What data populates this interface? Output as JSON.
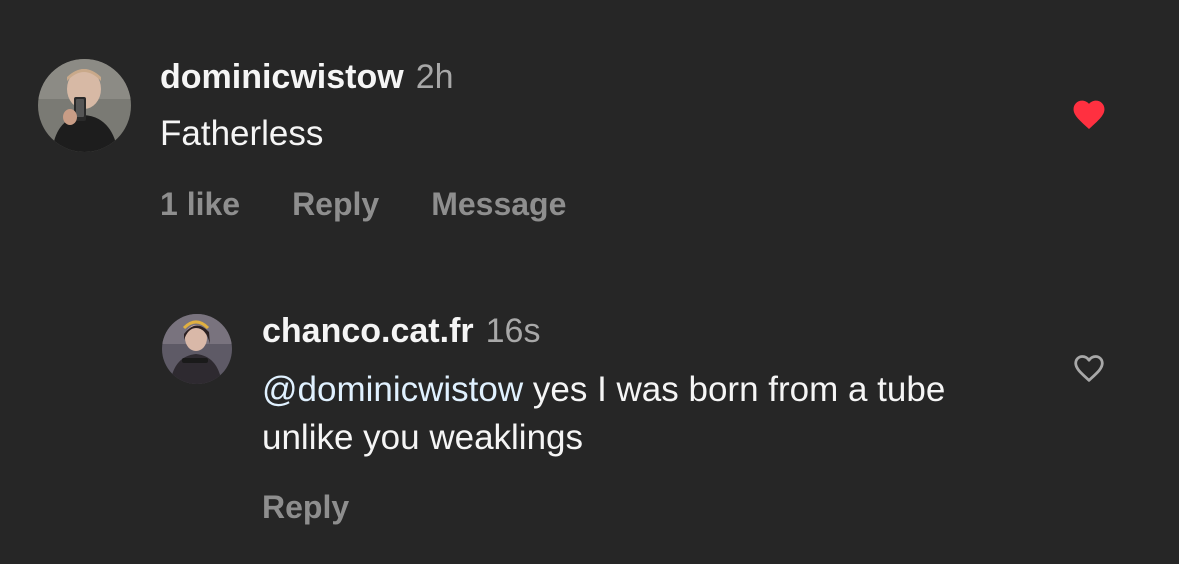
{
  "comments": [
    {
      "username": "dominicwistow",
      "time": "2h",
      "text": "Fatherless",
      "liked": true,
      "likes_label": "1 like",
      "reply_label": "Reply",
      "message_label": "Message"
    },
    {
      "username": "chanco.cat.fr",
      "time": "16s",
      "mention": "@dominicwistow",
      "text": " yes I was born from a tube unlike you weaklings",
      "liked": false,
      "reply_label": "Reply"
    }
  ],
  "colors": {
    "background": "#262626",
    "text": "#f5f5f5",
    "secondary": "#8e8e8e",
    "mention": "#e0f1ff",
    "like_red": "#ff3040"
  },
  "icons": {
    "filled_like": "heart-filled-icon",
    "outline_like": "heart-outline-icon"
  }
}
